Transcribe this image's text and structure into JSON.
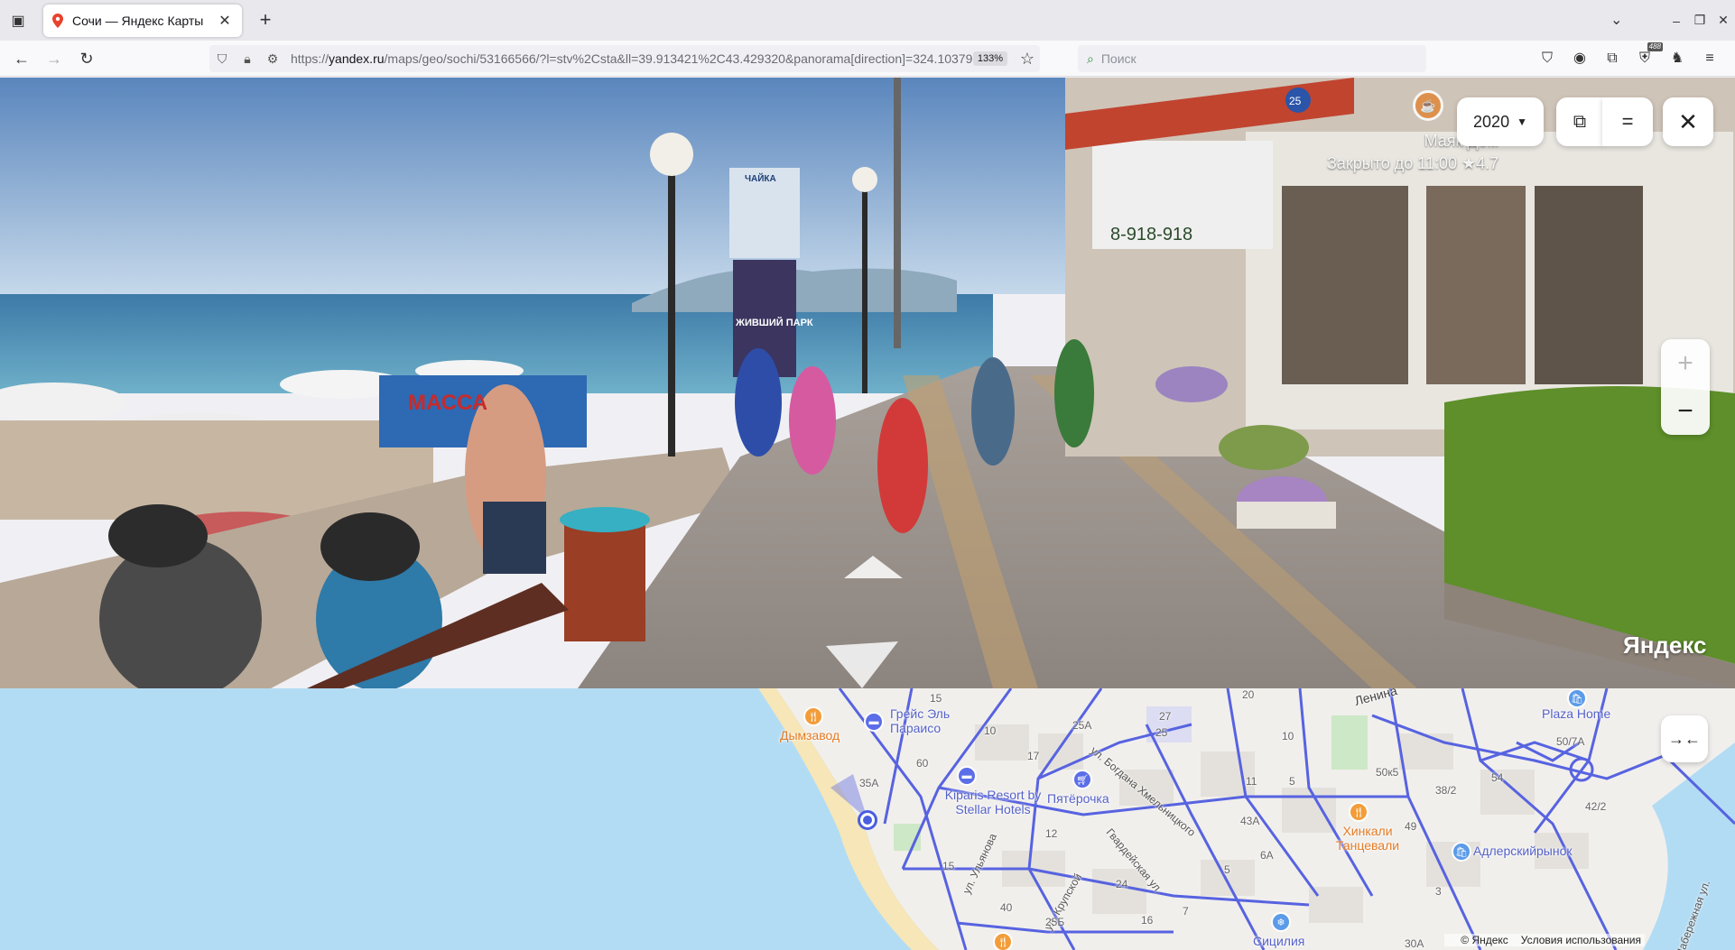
{
  "browser": {
    "tab_title": "Сочи — Яндекс Карты",
    "url_prefix": "https://",
    "url_domain": "yandex.ru",
    "url_rest": "/maps/geo/sochi/53166566/?l=stv%2Csta&ll=39.913421%2C43.429320&panorama[direction]=324.10379",
    "zoom": "133%",
    "search_placeholder": "Поиск",
    "extension_badge": "488"
  },
  "panorama": {
    "year": "2020",
    "poi_name": "Маяк Дом",
    "poi_status": "Закрыто до 11:00",
    "poi_rating": "★4.7",
    "watermark": "Яндекс",
    "sign_massage": "МАССА",
    "sign_chayka": "ЧАЙКА",
    "sign_park": "ЖИВШИЙ ПАРК",
    "sign_phone": "8-918-918",
    "sign_number": "25"
  },
  "map": {
    "labels": {
      "dymzavod": "Дымзавод",
      "greys": "Грейс Эль Параисо",
      "kiparis": "Kiparis Resort by Stellar Hotels",
      "pyaterochka": "Пятёрочка",
      "khinkali": "Хинкали Танцевали",
      "adler": "Адлерскийрынок",
      "plaza": "Plaza Home",
      "sicily": "Сицилия",
      "street_khmel": "ул. Богдана Хмельницкого",
      "street_ulyanova": "ул. Ульянова",
      "street_krupskoy": "ул. Крупской",
      "street_gvard": "Гвардейская ул.",
      "street_lenina": "Ленина",
      "street_nab": "Набережная ул."
    },
    "house_numbers": [
      "15",
      "20",
      "25А",
      "27",
      "10",
      "60",
      "17",
      "35А",
      "25",
      "11",
      "5",
      "43А",
      "50к5",
      "54",
      "38/2",
      "50/7А",
      "42/2",
      "49",
      "3",
      "12",
      "24",
      "40",
      "15",
      "16",
      "7",
      "5",
      "6А",
      "25Б",
      "30А",
      "10"
    ],
    "footer_copyright": "© Яндекс",
    "footer_terms": "Условия использования"
  }
}
